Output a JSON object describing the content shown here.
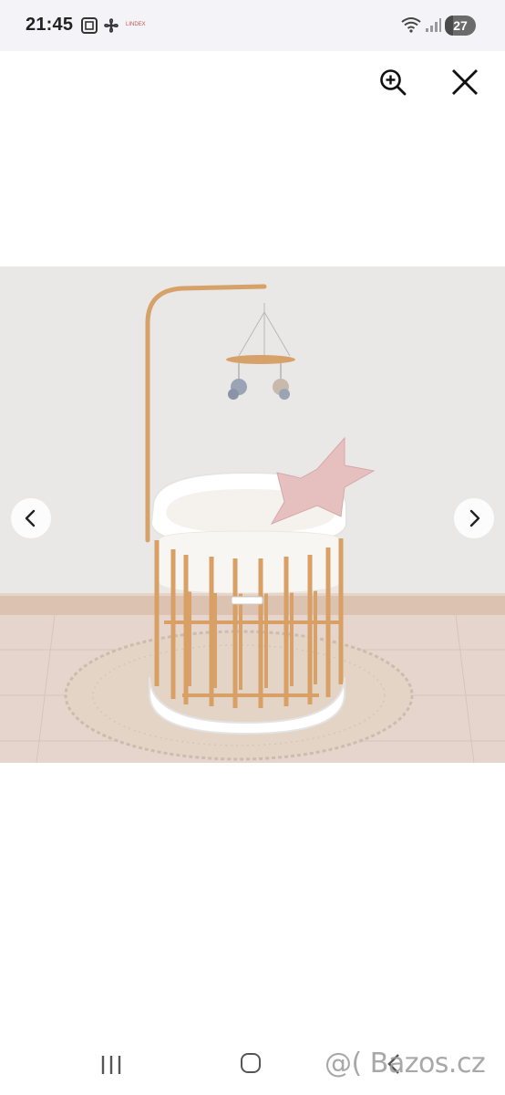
{
  "status_bar": {
    "time": "21:45",
    "brand_tiny": "LINDEX",
    "battery_level": "27",
    "icons": [
      "screenshot-icon",
      "pinwheel-icon",
      "wifi-icon",
      "signal-icon",
      "battery-icon"
    ]
  },
  "toolbar": {
    "zoom_icon": "zoom-in-icon",
    "close_icon": "close-icon"
  },
  "gallery": {
    "prev_icon": "chevron-left-icon",
    "next_icon": "chevron-right-icon",
    "image_subject": "oval wooden baby crib with mobile and pink star pillow"
  },
  "nav_bar": {
    "watermark": "@( Bazos.cz"
  },
  "colors": {
    "status_bg": "#f4f3f7",
    "wall": "#e9e7e4",
    "floor": "#e5d3cb",
    "wood": "#d7a26a",
    "pillow": "#e6bfbf"
  }
}
